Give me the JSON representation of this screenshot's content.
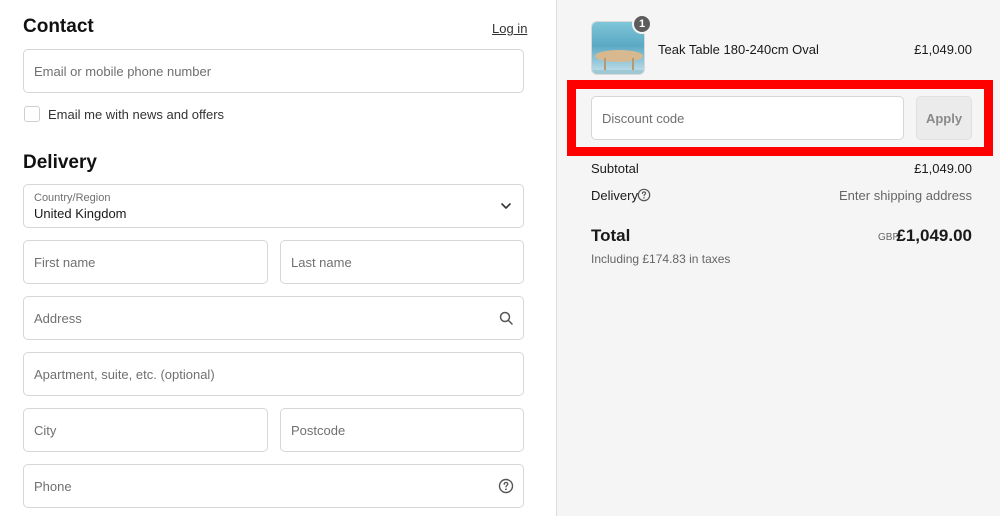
{
  "contact": {
    "title": "Contact",
    "login_link": "Log in",
    "email_placeholder": "Email or mobile phone number",
    "newsletter_label": "Email me with news and offers"
  },
  "delivery": {
    "title": "Delivery",
    "country_label": "Country/Region",
    "country_value": "United Kingdom",
    "first_name_placeholder": "First name",
    "last_name_placeholder": "Last name",
    "address_placeholder": "Address",
    "apartment_placeholder": "Apartment, suite, etc. (optional)",
    "city_placeholder": "City",
    "postcode_placeholder": "Postcode",
    "phone_placeholder": "Phone"
  },
  "summary": {
    "item": {
      "quantity": "1",
      "name": "Teak Table 180-240cm Oval",
      "price": "£1,049.00"
    },
    "discount_placeholder": "Discount code",
    "apply_label": "Apply",
    "subtotal_label": "Subtotal",
    "subtotal_value": "£1,049.00",
    "delivery_label": "Delivery",
    "delivery_value": "Enter shipping address",
    "total_label": "Total",
    "currency": "GBP",
    "total_value": "£1,049.00",
    "taxes_note": "Including £174.83 in taxes"
  },
  "colors": {
    "highlight": "#ff0000",
    "summary_bg": "#f5f5f5"
  }
}
